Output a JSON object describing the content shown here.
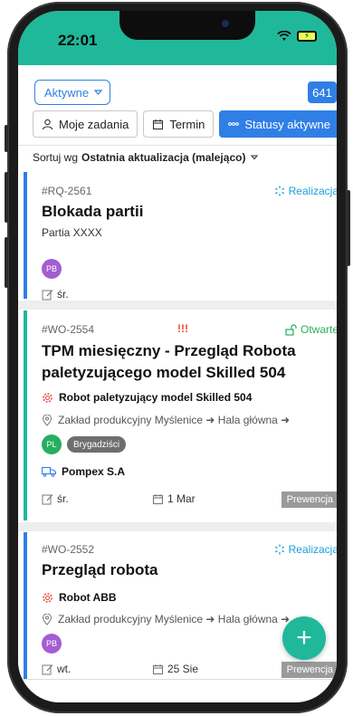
{
  "status_bar": {
    "time": "22:01"
  },
  "header": {
    "dropdown_label": "Aktywne",
    "count": "641"
  },
  "filters": [
    {
      "label": "Moje zadania",
      "icon": "person-icon",
      "active": false
    },
    {
      "label": "Termin",
      "icon": "calendar-icon",
      "active": false
    },
    {
      "label": "Statusy aktywne",
      "icon": "dots-icon",
      "active": true
    }
  ],
  "sort": {
    "prefix": "Sortuj wg",
    "value": "Ostatnia aktualizacja (malejąco)"
  },
  "colors": {
    "accent": "#1fb89a",
    "primary": "#2f7fe6",
    "open": "#27ae60",
    "priority": "#e74c3c"
  },
  "cards": [
    {
      "id": "#RQ-2561",
      "status": "Realizacja",
      "title": "Blokada partii",
      "subtitle": "Partia XXXX",
      "avatar": "PB",
      "day": "śr."
    },
    {
      "id": "#WO-2554",
      "priority": "!!!",
      "status": "Otwarte",
      "title": "TPM miesięczny - Przegląd Robota paletyzującego model Skilled 504",
      "asset": "Robot paletyzujący model Skilled 504",
      "location": "Zakład produkcyjny Myślenice ➜ Hala główna ➜",
      "avatar": "PL",
      "team": "Brygadziści",
      "vendor": "Pompex S.A",
      "day": "śr.",
      "date": "1 Mar",
      "type": "Prewencja"
    },
    {
      "id": "#WO-2552",
      "status": "Realizacja",
      "title": "Przegląd robota",
      "asset": "Robot ABB",
      "location": "Zakład produkcyjny Myślenice ➜ Hala główna ➜",
      "avatar": "PB",
      "day": "wt.",
      "date": "25 Sie",
      "type": "Prewencja"
    }
  ],
  "fab": {
    "label": "+"
  }
}
